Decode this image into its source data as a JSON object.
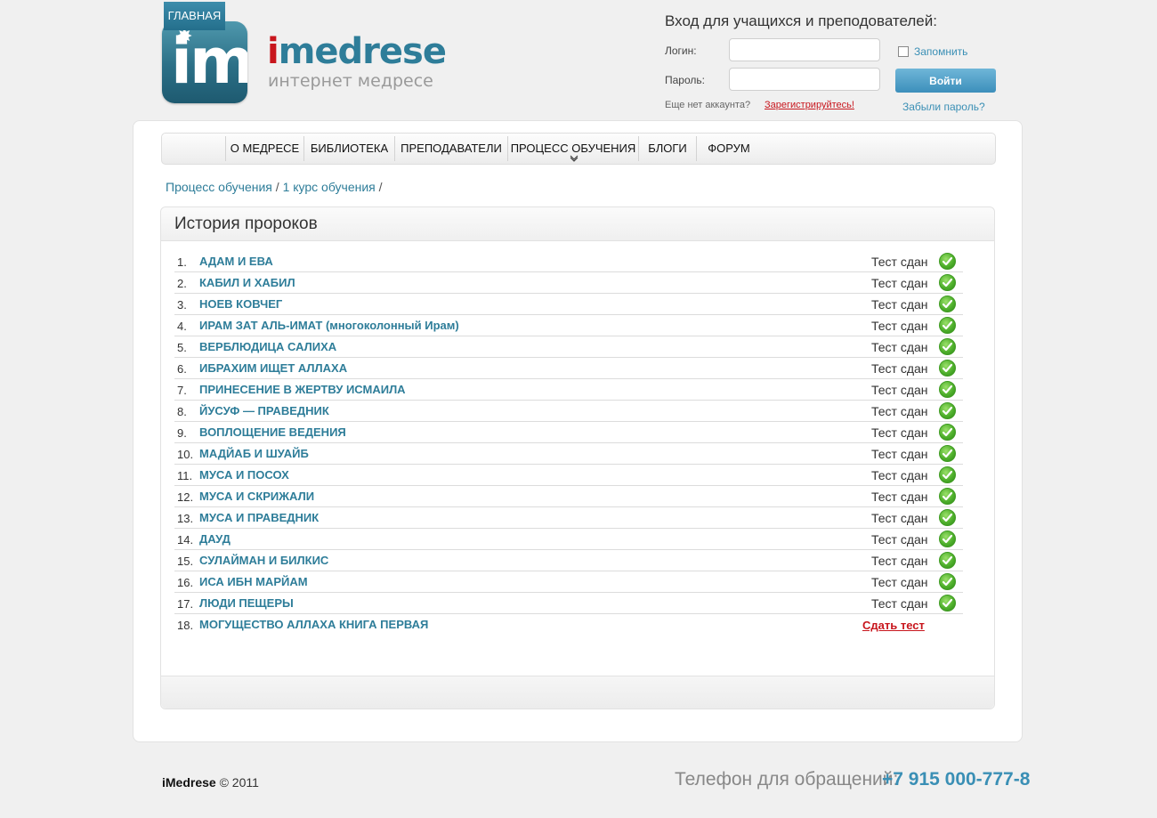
{
  "brand": {
    "logo_letters": "im",
    "logo_prefix": "i",
    "logo_name": "medrese",
    "tagline": "интернет медресе"
  },
  "login": {
    "title": "Вход для учащихся и преподователей:",
    "login_label": "Логин:",
    "password_label": "Пароль:",
    "login_value": "",
    "password_value": "",
    "remember_label": "Запомнить",
    "submit_label": "Войти",
    "no_account_text": "Еще нет аккаунта?",
    "register_label": "Зарегистрируйтесь!",
    "forgot_label": "Забыли пароль?"
  },
  "nav": [
    {
      "label": "Главная",
      "active": true
    },
    {
      "label": "О медресе",
      "active": false
    },
    {
      "label": "Библиотека",
      "active": false
    },
    {
      "label": "Преподаватели",
      "active": false
    },
    {
      "label": "Процесс обучения",
      "active": false,
      "has_dropdown": true
    },
    {
      "label": "Блоги",
      "active": false
    },
    {
      "label": "Форум",
      "active": false
    }
  ],
  "breadcrumb": {
    "items": [
      "Процесс обучения",
      "1 курс обучения"
    ],
    "separator": "/"
  },
  "course": {
    "title": "История пророков",
    "lessons": [
      {
        "num": "1.",
        "title": "АДАМ И ЕВА",
        "status": "Тест сдан",
        "passed": true
      },
      {
        "num": "2.",
        "title": "КАБИЛ И ХАБИЛ",
        "status": "Тест сдан",
        "passed": true
      },
      {
        "num": "3.",
        "title": "НОЕВ КОВЧЕГ",
        "status": "Тест сдан",
        "passed": true
      },
      {
        "num": "4.",
        "title": "ИРАМ ЗАТ АЛЬ-ИМАТ (многоколонный Ирам)",
        "status": "Тест сдан",
        "passed": true
      },
      {
        "num": "5.",
        "title": "ВЕРБЛЮДИЦА САЛИХА",
        "status": "Тест сдан",
        "passed": true
      },
      {
        "num": "6.",
        "title": "ИБРАХИМ ИЩЕТ АЛЛАХА",
        "status": "Тест сдан",
        "passed": true
      },
      {
        "num": "7.",
        "title": "ПРИНЕСЕНИЕ В ЖЕРТВУ ИСМАИЛА",
        "status": "Тест сдан",
        "passed": true
      },
      {
        "num": "8.",
        "title": "ЙУСУФ — ПРАВЕДНИК",
        "status": "Тест сдан",
        "passed": true
      },
      {
        "num": "9.",
        "title": "ВОПЛОЩЕНИЕ ВЕДЕНИЯ",
        "status": "Тест сдан",
        "passed": true
      },
      {
        "num": "10.",
        "title": "МАДЙАБ И ШУАЙБ",
        "status": "Тест сдан",
        "passed": true
      },
      {
        "num": "11.",
        "title": "МУСА И ПОСОХ",
        "status": "Тест сдан",
        "passed": true
      },
      {
        "num": "12.",
        "title": "МУСА И СКРИЖАЛИ",
        "status": "Тест сдан",
        "passed": true
      },
      {
        "num": "13.",
        "title": "МУСА И ПРАВЕДНИК",
        "status": "Тест сдан",
        "passed": true
      },
      {
        "num": "14.",
        "title": "ДАУД",
        "status": "Тест сдан",
        "passed": true
      },
      {
        "num": "15.",
        "title": "СУЛАЙМАН И БИЛКИС",
        "status": "Тест сдан",
        "passed": true
      },
      {
        "num": "16.",
        "title": "ИСА ИБН МАРЙАМ",
        "status": "Тест сдан",
        "passed": true
      },
      {
        "num": "17.",
        "title": "ЛЮДИ ПЕЩЕРЫ",
        "status": "Тест сдан",
        "passed": true
      },
      {
        "num": "18.",
        "title": "МОГУЩЕСТВО АЛЛАХА КНИГА ПЕРВАЯ",
        "status": "Сдать тест",
        "passed": false
      }
    ]
  },
  "footer": {
    "brand": "iMedrese",
    "copyright": "© 2011",
    "phone_label": "Телефон для обращений:",
    "phone_number": "+7 915 000-777-8"
  },
  "colors": {
    "accent": "#2e7d99",
    "link_red": "#c8161d",
    "check_green": "#4fb02c"
  }
}
